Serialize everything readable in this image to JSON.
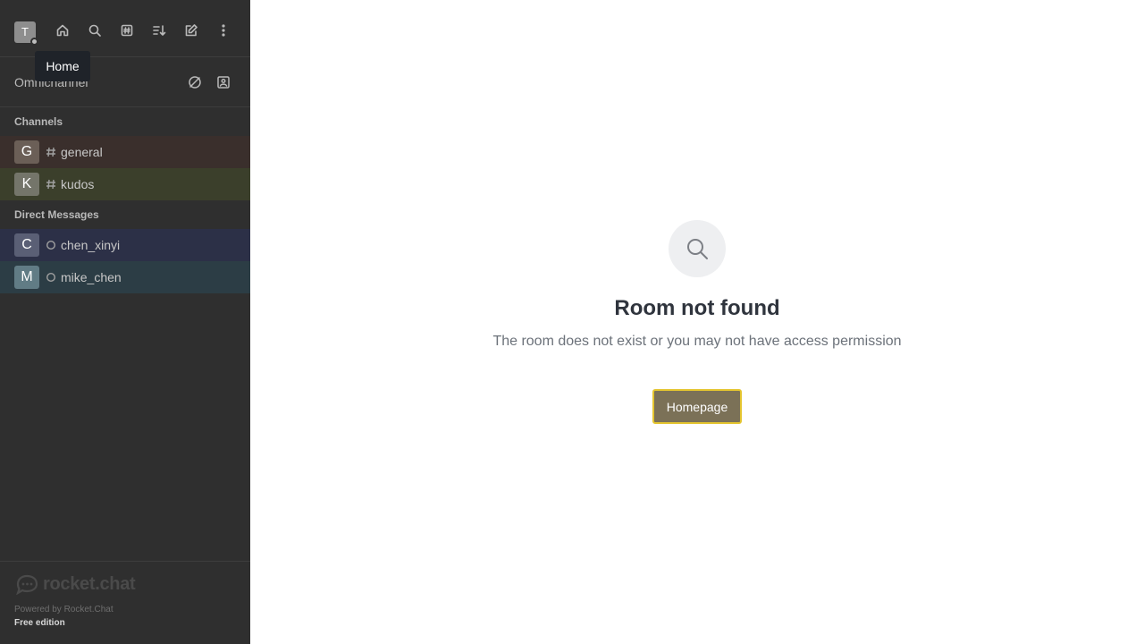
{
  "tooltip": {
    "text": "Home"
  },
  "user": {
    "avatar_initial": "T",
    "presence_color": "#bdbdbd"
  },
  "topbar_icons": [
    "home-icon",
    "search-icon",
    "directory-icon",
    "sort-icon",
    "create-new-icon",
    "kebab-menu-icon"
  ],
  "omnichannel": {
    "label": "Omnichannel",
    "icons": [
      "omnichannel-offline-icon",
      "contact-center-icon"
    ]
  },
  "sections": {
    "channels": "Channels",
    "direct_messages": "Direct Messages"
  },
  "channels": [
    {
      "initial": "G",
      "name": "general",
      "avatar_color": "#6b5f57"
    },
    {
      "initial": "K",
      "name": "kudos",
      "avatar_color": "#74756a"
    }
  ],
  "direct_messages": [
    {
      "initial": "C",
      "name": "chen_xinyi",
      "avatar_color": "#5a5f75"
    },
    {
      "initial": "M",
      "name": "mike_chen",
      "avatar_color": "#617c85"
    }
  ],
  "footer": {
    "logo_text": "rocket.chat",
    "powered_by": "Powered by Rocket.Chat",
    "edition": "Free edition"
  },
  "main": {
    "title": "Room not found",
    "description": "The room does not exist or you may not have access permission",
    "button_label": "Homepage"
  },
  "colors": {
    "sidebar_bg": "#2f2f2f",
    "button_bg": "#7b7157",
    "button_border": "#e4c52f"
  }
}
